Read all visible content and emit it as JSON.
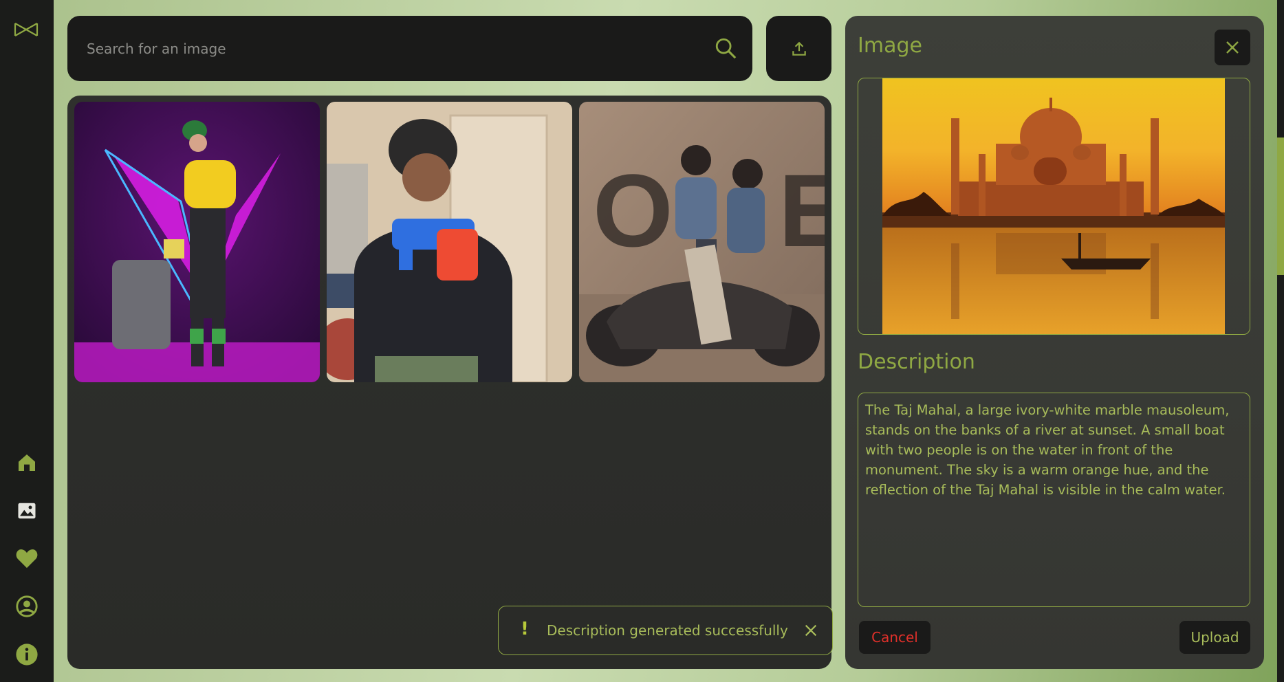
{
  "search": {
    "placeholder": "Search for an image"
  },
  "sidebar": {
    "items": [
      {
        "icon": "home-icon"
      },
      {
        "icon": "image-icon"
      },
      {
        "icon": "heart-icon"
      },
      {
        "icon": "user-icon"
      },
      {
        "icon": "info-icon"
      }
    ]
  },
  "panel": {
    "title": "Image",
    "description_title": "Description",
    "description": "The Taj Mahal, a large ivory-white marble mausoleum, stands on the banks of a river at sunset. A small boat with two people is on the water in front of the monument. The sky is a warm orange hue, and the reflection of the Taj Mahal is visible in the calm water.",
    "cancel_label": "Cancel",
    "upload_label": "Upload"
  },
  "toast": {
    "mark": "!",
    "message": "Description generated successfully"
  },
  "colors": {
    "accent": "#8fa843",
    "danger": "#e0302a",
    "dark": "#1a1a19"
  }
}
